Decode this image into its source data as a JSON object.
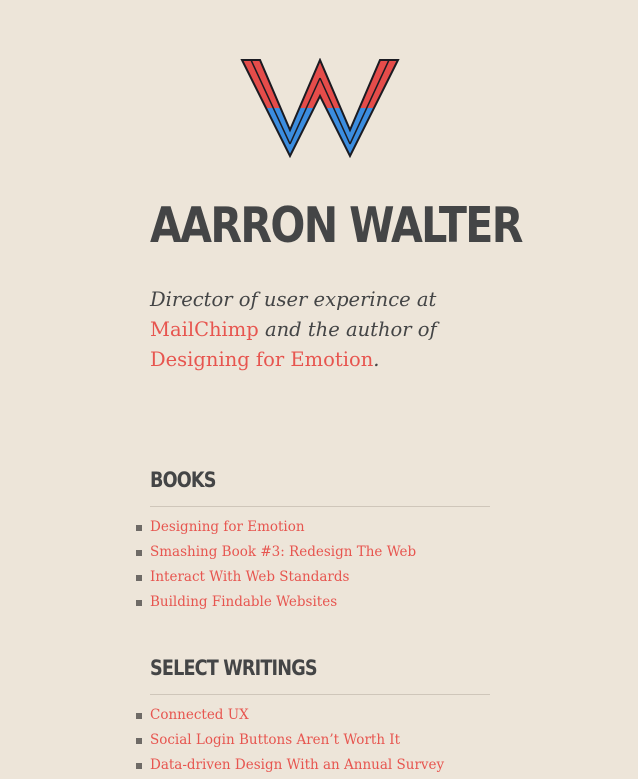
{
  "logo": {
    "icon": "w-monogram-icon",
    "colors": {
      "top": "#e54c4a",
      "bottom": "#3b8de0",
      "outline": "#1b1b22"
    }
  },
  "author": {
    "name": "AARRON WALTER"
  },
  "bio": {
    "part1": "Director of user experince at ",
    "link1": "MailChimp",
    "part2": " and the author of ",
    "link2": "Designing for Emotion",
    "part3": "."
  },
  "books": {
    "title": "BOOKS",
    "items": [
      {
        "label": "Designing for Emotion"
      },
      {
        "label": "Smashing Book #3: Redesign The Web"
      },
      {
        "label": "Interact With Web Standards"
      },
      {
        "label": "Building Findable Websites"
      }
    ]
  },
  "writings": {
    "title": "SELECT WRITINGS",
    "items": [
      {
        "label": "Connected UX"
      },
      {
        "label": "Social Login Buttons Aren’t Worth It"
      },
      {
        "label": "Data-driven Design With an Annual Survey"
      }
    ]
  },
  "theme": {
    "background": "#ede5d9",
    "link": "#e7554f",
    "text": "#444546"
  }
}
